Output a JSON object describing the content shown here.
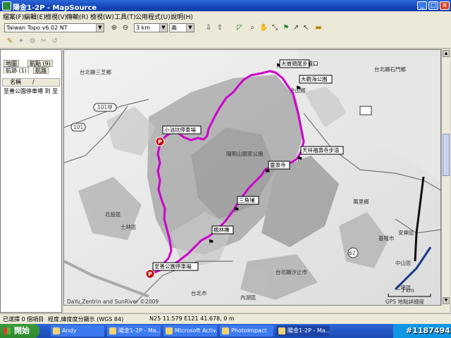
{
  "window": {
    "title": "陽金1-2P - MapSource"
  },
  "menu": [
    "檔案(F)",
    "編輯(E)",
    "檢視(V)",
    "傳輸(R)",
    "檢視(W)",
    "工具(T)",
    "公用程式(U)",
    "說明(H)"
  ],
  "toolbar": {
    "map_product": "Taiwan Topo v6.02 NT",
    "zoom_scale": "3 km",
    "detail": "高"
  },
  "left_panel": {
    "tabs_top": [
      "地圖",
      "航點 (9)"
    ],
    "tabs_bottom": [
      "航跡 (1)",
      "航路"
    ],
    "column_name": "名稱",
    "column_sort": "/",
    "items": [
      "至善公園停車場 到 至"
    ]
  },
  "map": {
    "place_labels": [
      "台北縣三芝鄉",
      "台北市",
      "士林區",
      "北投區",
      "內湖區",
      "萬里鄉",
      "金山鄉",
      "基隆市",
      "安樂區",
      "中山區",
      "七堵區",
      "台北縣汐止市",
      "陽明山國家公園",
      "台北縣石門鄉"
    ],
    "road_labels": [
      "101甲",
      "101",
      "62"
    ],
    "waypoints": [
      "小油坑停車場",
      "大崙頭尾步道口",
      "大觀海公園",
      "天祥福壽寺步道",
      "靈泉寺",
      "三角埔",
      "楓林橋",
      "至善公園停車場"
    ],
    "copyright": "DaYu,Zentrin and SunRiver ©2009",
    "scale_label": "3 km",
    "gps_note": "GPS 地點詳細度"
  },
  "status": {
    "selection": "已選擇 0 個項目",
    "coord_format": "經度,緯度度分顯示 (WGS 84)",
    "coordinates": "N25 11.579 E121 41.678, 0 m"
  },
  "taskbar": {
    "start": "開始",
    "tasks": [
      "Andy",
      "陽金1-2P - Ma...",
      "Microsoft Activ...",
      "PhotoImpact",
      "陽金1-2P - Ma..."
    ],
    "watermark": "#1187494"
  }
}
